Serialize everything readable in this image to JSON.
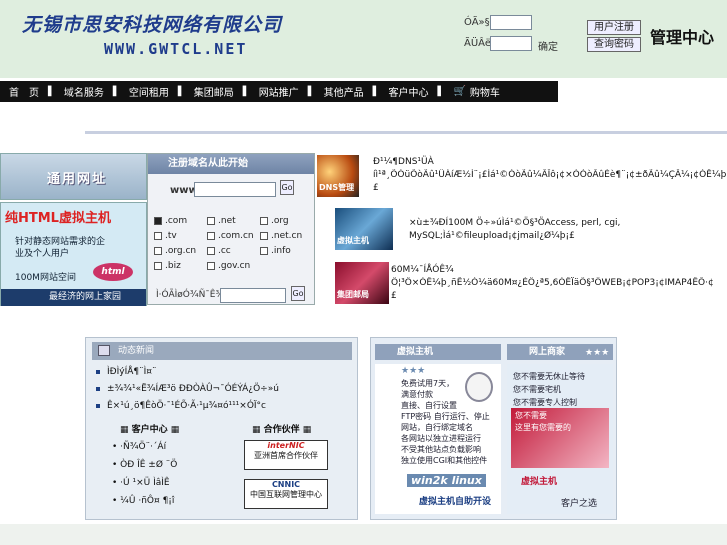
{
  "header": {
    "company_name": "无锡市思安科技网络有限公司",
    "website": "WWW.GWTCL.NET",
    "login": {
      "user_label": "ÓÃ»§",
      "pass_label": "ÃÜÂë",
      "confirm_label": "确定",
      "register_label": "用户注册",
      "query_label": "查询密码"
    },
    "admin_title": "管理中心"
  },
  "nav": {
    "items": [
      "首　页",
      "域名服务",
      "空间租用",
      "集团邮局",
      "网站推广",
      "其他产品",
      "客户中心",
      "购物车"
    ]
  },
  "left_banners": {
    "banner1_text": "通用网址",
    "banner2_title": "纯HTML虚拟主机",
    "banner2_body": "针对静态网站需求的企业及个人用户",
    "banner2_space": "100M网站空间",
    "banner2_badge": "html",
    "banner2_footer": "最经济的网上家园"
  },
  "domain_search": {
    "header": "注册域名从此开始",
    "www_label": "www.",
    "go_label": "Go",
    "rows": [
      [
        {
          "ext": ".com",
          "checked": true
        },
        {
          "ext": ".net",
          "checked": false
        },
        {
          "ext": ".org",
          "checked": false
        }
      ],
      [
        {
          "ext": ".tv",
          "checked": false
        },
        {
          "ext": ".com.cn",
          "checked": false
        },
        {
          "ext": ".net.cn",
          "checked": false
        }
      ],
      [
        {
          "ext": ".org.cn",
          "checked": false
        },
        {
          "ext": ".cc",
          "checked": false
        },
        {
          "ext": ".info",
          "checked": false
        }
      ],
      [
        {
          "ext": ".biz",
          "checked": false
        },
        {
          "ext": ".gov.cn",
          "checked": false
        }
      ]
    ],
    "footer_label": "Ì·ÓÃÌøÓ¾Ñ¯Ê¾:",
    "footer_go": "Go"
  },
  "services": [
    {
      "img_label": "DNS管理",
      "text1": "Ð¹¼¶DNS¹ÜÀ",
      "text2": "íì¹ª¸ÕÓüÔòÃû¹ÜÀíÆ½Ì¨¡£Ìá¹©ÓòÃû¼ÂÎô¡¢×ÓÓòÃûÉè¶¨¡¢±ðÃû¼ÇÂ¼¡¢ÓÊ¼þ×¡¢¹ÜÀ",
      "text3": "£"
    },
    {
      "img_label": "虚拟主机",
      "text1": "×ù±¾ÐÍ100M Ö÷»úÌá¹©Ö§³ÖAccess, perl, cgi,",
      "text2": "MySQL;Ìá¹©fileupload¡¢jmail¿Ø¼þ¡£"
    },
    {
      "img_label": "集团邮局",
      "text1": "60M¼¯ÍÅÓÊ¾",
      "text2": "Ö¦³Ö×ÓÊ¼þ¸ñÊ½Ó¼ä60M¤¿ÉÖ¿ª5,6ÓÊÏäÖ§³ÖWEB¡¢POP3¡¢IMAP4ÊÕ·¢",
      "text3": "£"
    }
  ],
  "news": {
    "header": "动态新闻",
    "items": [
      "ÌÐÌýÍÅ¶¨Ì¤¨",
      "±¾¾¹«Ë¾ÍÆ³ö ÐÐÒÀÛ¬¯ÓÉÝÁ¿Ö÷»ú",
      "Ê×¹ú¸ö¶ÊòÖ·¯¹ÉÕ·Ã·¹µ¾¤ó¹¹¹×ÓÏ°c"
    ],
    "customer_header": "客户中心",
    "customer_links": [
      "·Ñ¾Ö¨·´Áí",
      "ÒÐ ÎÊ ±Ø ¨Ö",
      "·Ú ¹×Ü ÌâÌÊ",
      "¼Û ·ñÔ¤ ¶¡î"
    ],
    "partners_header": "合作伙伴",
    "partner1_logo": "interNIC",
    "partner1_text": "亚洲首席合作伙伴",
    "partner2_logo": "CNNIC",
    "partner2_text": "中国互联网管理中心"
  },
  "right_panel": {
    "left_head": "虚拟主机",
    "right_head": "网上商家",
    "left_lines": [
      "免费试用7天，",
      "满意付款",
      "直接、自行设置",
      "FTP密码 自行运行、停止",
      "网站，自行绑定域名",
      "各网站以独立进程运行",
      "不受其他站点负载影响",
      "独立使用CGI和其他控件"
    ],
    "left_footer": "虚拟主机自助开设",
    "left_logo": "win2k linux",
    "right_lines": [
      "您不需要无休止等待",
      "您不需要宅机",
      "您不需要专人控制"
    ],
    "right_lines2": [
      "您不需要",
      "这里有您需要的"
    ],
    "right_footer1": "虚拟主机",
    "right_footer2": "客户之选"
  },
  "colors": {
    "header_bg": "#dfeedf",
    "brand_blue": "#1f3c8c",
    "nav_bg": "#111111"
  }
}
